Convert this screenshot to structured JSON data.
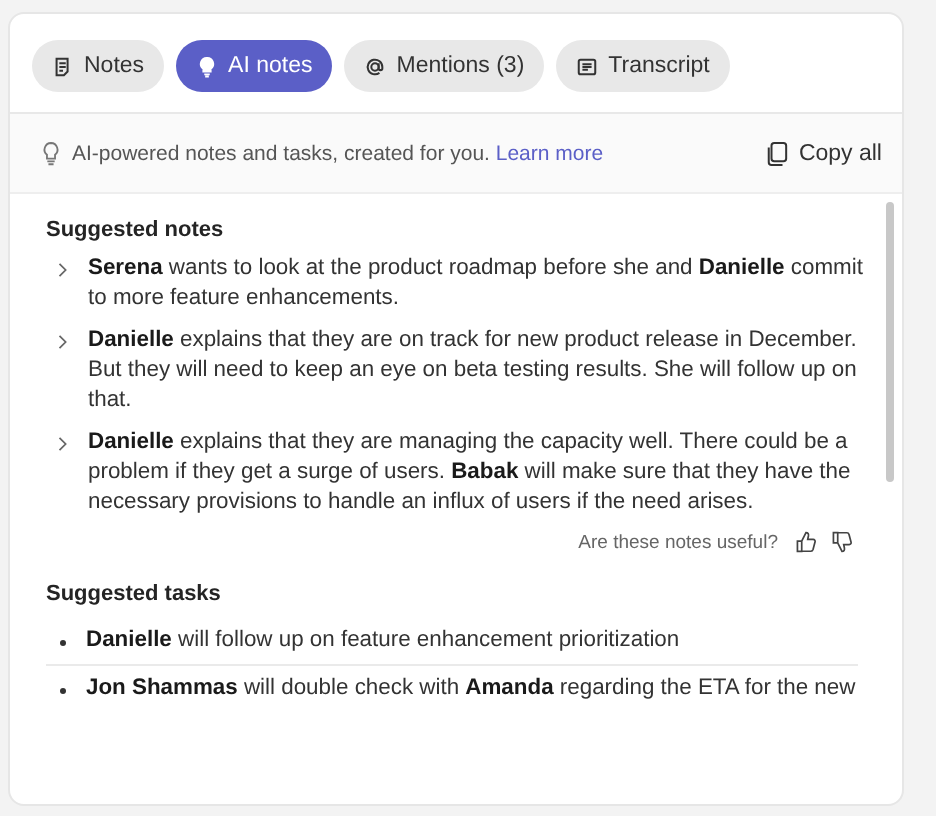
{
  "tabs": [
    {
      "label": "Notes",
      "kind": "notes",
      "selected": false
    },
    {
      "label": "AI notes",
      "kind": "bulb",
      "selected": true
    },
    {
      "label": "Mentions (3)",
      "kind": "at",
      "selected": false
    },
    {
      "label": "Transcript",
      "kind": "transcript",
      "selected": false
    }
  ],
  "info_bar": {
    "text": "AI-powered notes and tasks, created for you.",
    "link": "Learn more",
    "copy_button": "Copy all"
  },
  "suggested_notes": {
    "heading": "Suggested notes",
    "items": [
      "**Serena** wants to look at the product roadmap before she and **Danielle** commit to more feature enhancements.",
      "**Danielle** explains that they are on track for new product release in December. But they will need to keep an eye on beta testing results. She will follow up on that.",
      "**Danielle** explains that they are managing the capacity well. There could be a problem if they get a surge of users. **Babak** will make sure that they have the necessary provisions to handle an influx of users if the need arises."
    ],
    "feedback_prompt": "Are these notes useful?"
  },
  "suggested_tasks": {
    "heading": "Suggested tasks",
    "items": [
      "**Danielle** will follow up on feature enhancement prioritization",
      "**Jon Shammas** will double check with **Amanda** regarding the ETA for the new"
    ]
  }
}
